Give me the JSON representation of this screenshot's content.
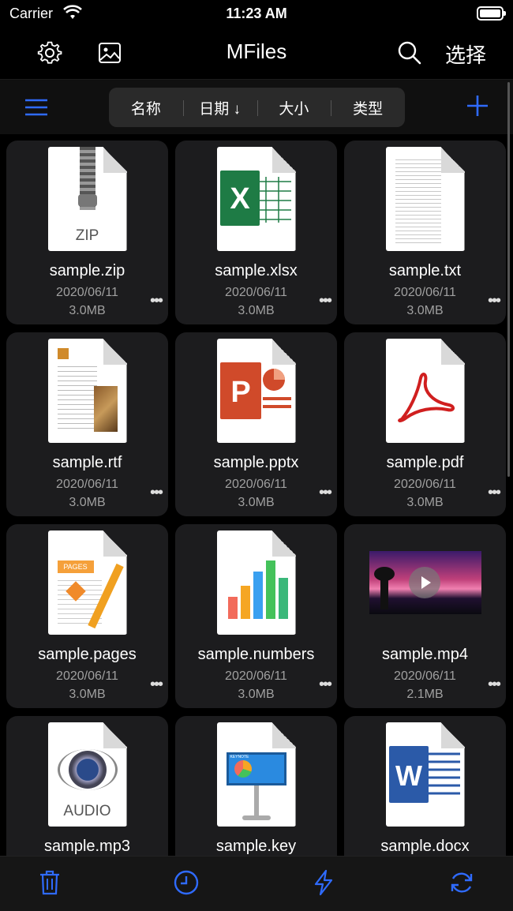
{
  "status": {
    "carrier": "Carrier",
    "time": "11:23 AM"
  },
  "nav": {
    "title": "MFiles",
    "select_label": "选择"
  },
  "sort": {
    "name": "名称",
    "date": "日期 ↓",
    "size": "大小",
    "type": "类型"
  },
  "files": [
    {
      "name": "sample.zip",
      "date": "2020/06/11",
      "size": "3.0MB",
      "icon": "zip-file-icon",
      "label": "ZIP"
    },
    {
      "name": "sample.xlsx",
      "date": "2020/06/11",
      "size": "3.0MB",
      "icon": "excel-file-icon"
    },
    {
      "name": "sample.txt",
      "date": "2020/06/11",
      "size": "3.0MB",
      "icon": "text-file-icon"
    },
    {
      "name": "sample.rtf",
      "date": "2020/06/11",
      "size": "3.0MB",
      "icon": "rtf-file-icon"
    },
    {
      "name": "sample.pptx",
      "date": "2020/06/11",
      "size": "3.0MB",
      "icon": "powerpoint-file-icon"
    },
    {
      "name": "sample.pdf",
      "date": "2020/06/11",
      "size": "3.0MB",
      "icon": "pdf-file-icon"
    },
    {
      "name": "sample.pages",
      "date": "2020/06/11",
      "size": "3.0MB",
      "icon": "pages-file-icon",
      "label": "PAGES"
    },
    {
      "name": "sample.numbers",
      "date": "2020/06/11",
      "size": "3.0MB",
      "icon": "numbers-file-icon"
    },
    {
      "name": "sample.mp4",
      "date": "2020/06/11",
      "size": "2.1MB",
      "icon": "video-thumbnail"
    },
    {
      "name": "sample.mp3",
      "date": "",
      "size": "",
      "icon": "audio-file-icon",
      "label": "AUDIO"
    },
    {
      "name": "sample.key",
      "date": "",
      "size": "",
      "icon": "keynote-file-icon",
      "label": "KEYNOTE"
    },
    {
      "name": "sample.docx",
      "date": "",
      "size": "",
      "icon": "word-file-icon"
    }
  ],
  "colors": {
    "accent": "#2f6bff",
    "card": "#1c1c1e",
    "excel": "#1e7b45",
    "powerpoint": "#d04a2a",
    "pdf": "#d01f1f",
    "word": "#2b5aa8"
  }
}
